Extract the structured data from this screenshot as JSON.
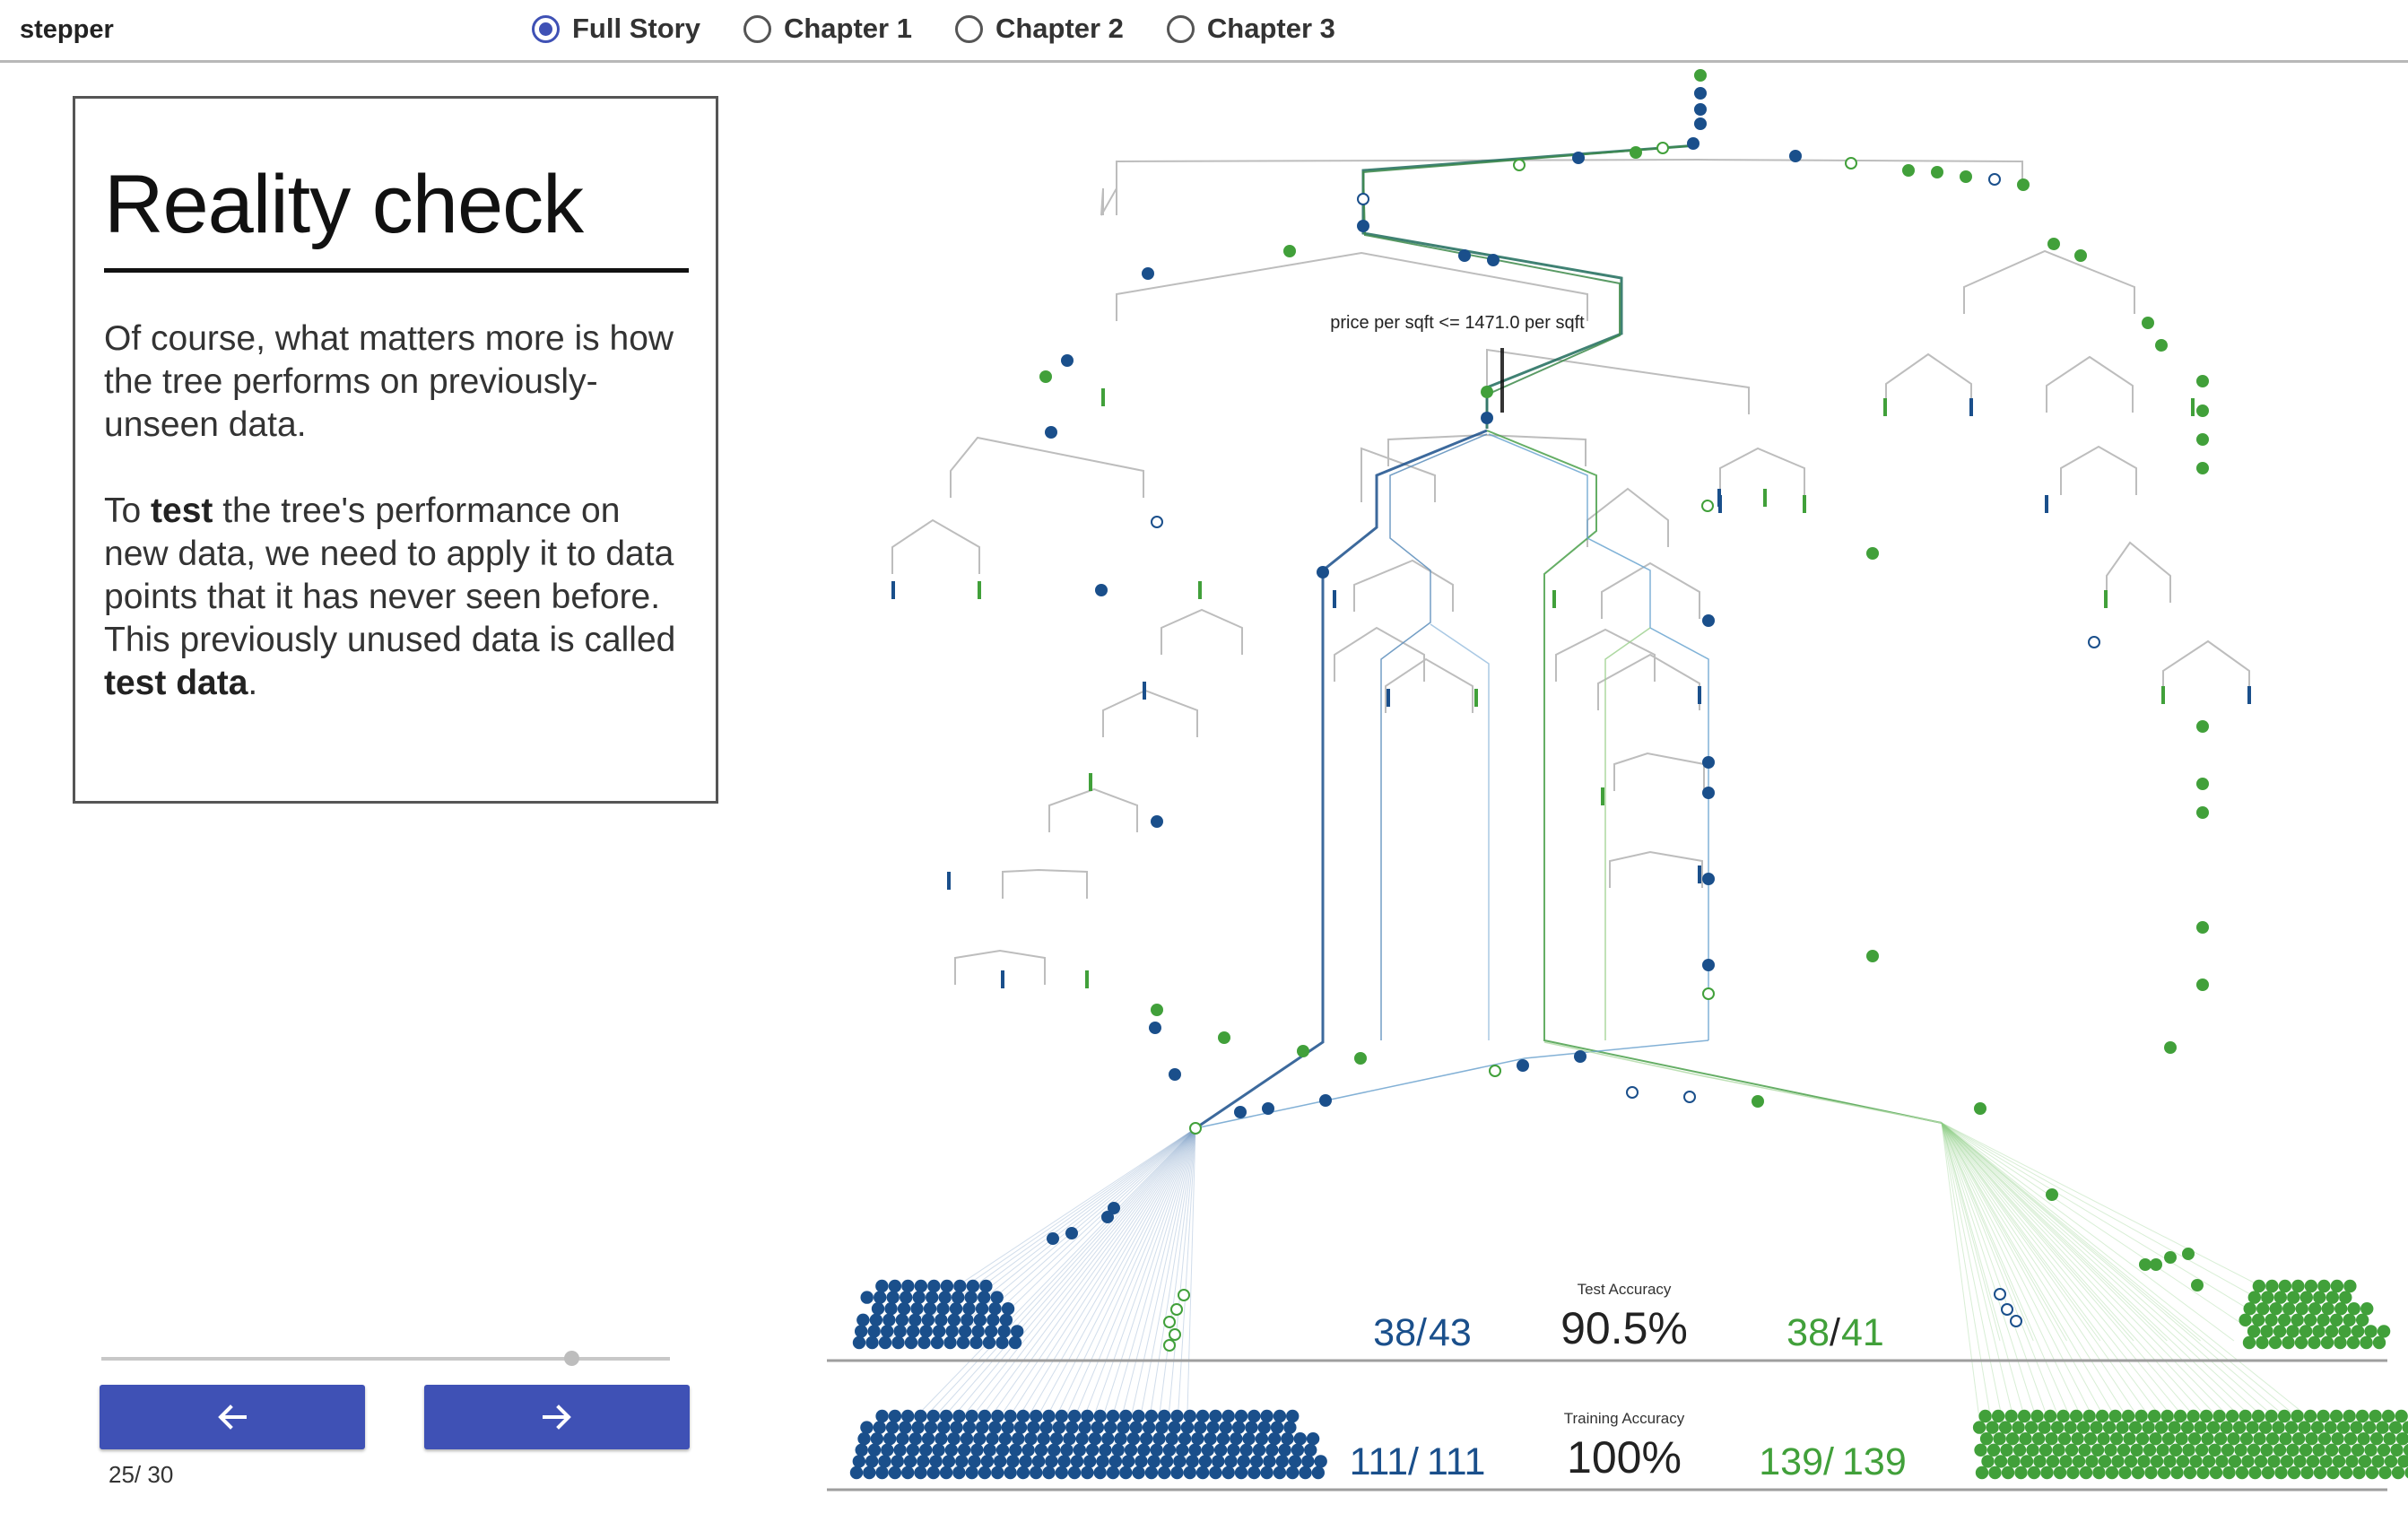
{
  "app": {
    "title": "stepper"
  },
  "chapters": [
    {
      "label": "Full Story",
      "selected": true
    },
    {
      "label": "Chapter 1",
      "selected": false
    },
    {
      "label": "Chapter 2",
      "selected": false
    },
    {
      "label": "Chapter 3",
      "selected": false
    }
  ],
  "story": {
    "title": "Reality check",
    "paragraph1": "Of course, what matters more is how the tree performs on previously-unseen data.",
    "paragraph2": {
      "t1": "To ",
      "b1": "test",
      "t2": " the tree's performance on new data, we need to apply it to data points that it has never seen before. This previously unused data is called ",
      "b2": "test data",
      "t3": "."
    }
  },
  "navigation": {
    "prev_icon": "arrow-left-icon",
    "next_icon": "arrow-right-icon",
    "current_step": 25,
    "total_steps": 30,
    "counter_text": "25/ 30",
    "progress": 0.8
  },
  "tree": {
    "split_label": "price per sqft <= 1471.0 per sqft"
  },
  "test_results": {
    "label": "Test Accuracy",
    "accuracy": "90.5%",
    "left_correct": "38",
    "left_total": "43",
    "right_correct": "38",
    "right_total": "41"
  },
  "training_results": {
    "label": "Training Accuracy",
    "accuracy": "100%",
    "left_correct": "111",
    "left_total": "111",
    "right_correct": "139",
    "right_total": "139"
  },
  "colors": {
    "blue": "#1a4f8b",
    "green": "#41a03a",
    "accent": "#3f51b5",
    "gray_line": "#bdbdbd"
  }
}
